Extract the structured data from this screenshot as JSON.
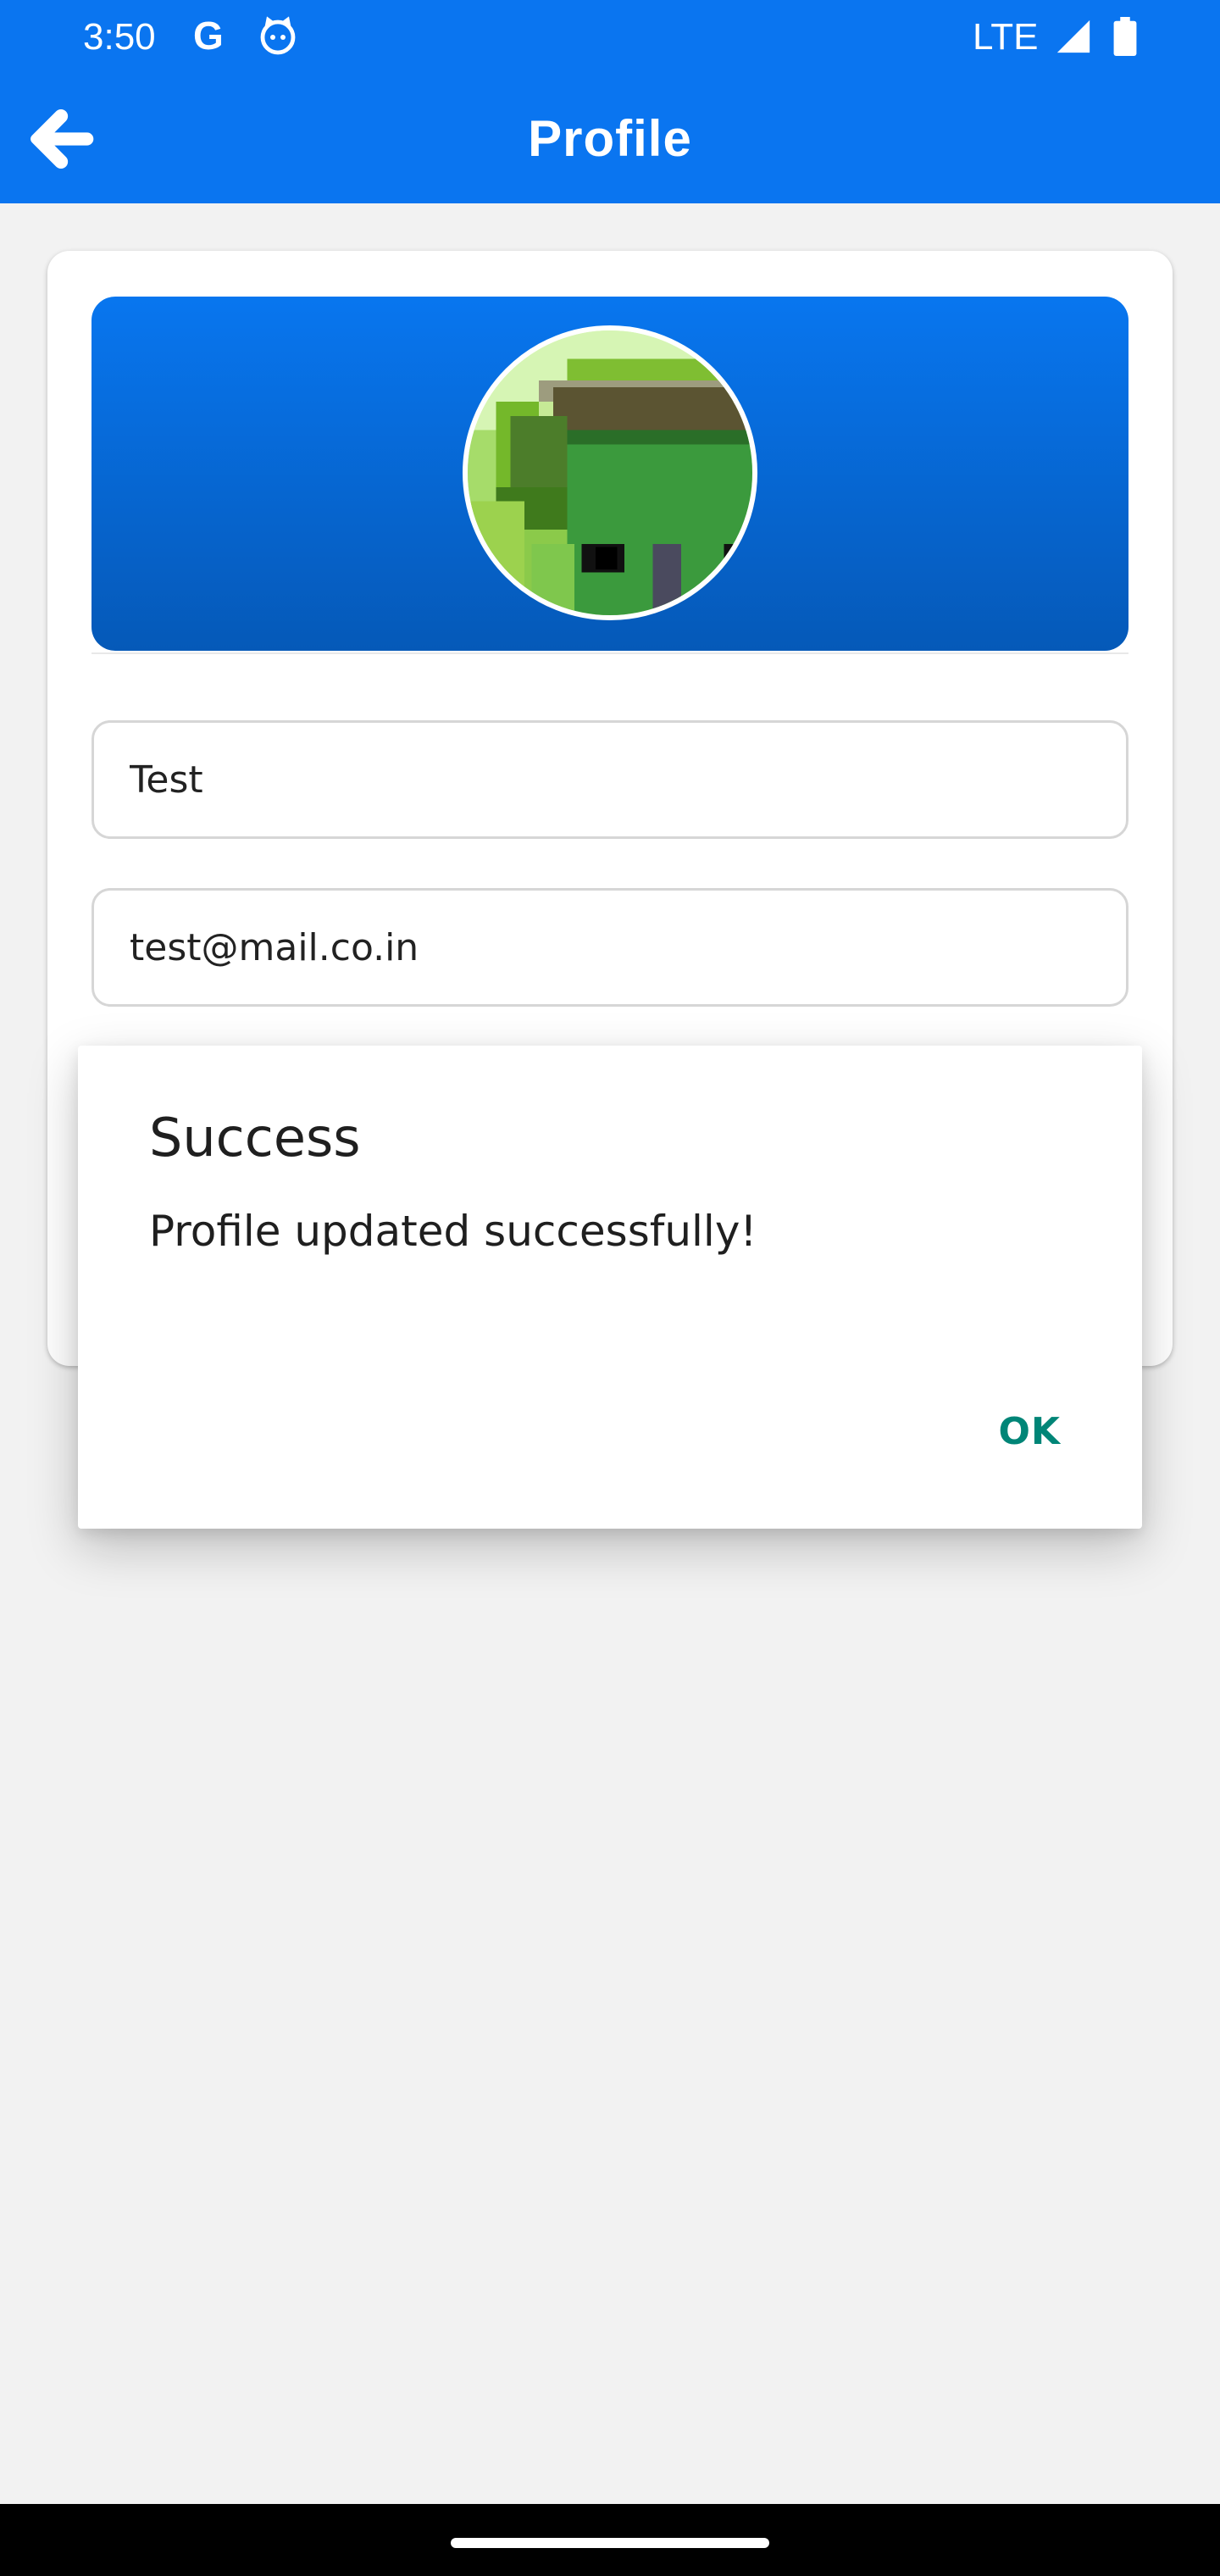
{
  "status_bar": {
    "time": "3:50",
    "google_icon": "G",
    "network": "LTE",
    "icons": [
      "google-icon",
      "cat-notification-icon",
      "signal-icon",
      "battery-icon"
    ]
  },
  "app_bar": {
    "title": "Profile",
    "back_icon": "arrow-left-icon",
    "color": "#0a75f0"
  },
  "profile": {
    "avatar_icon": "pixel-art-avatar",
    "name_value": "Test",
    "email_value": "test@mail.co.in"
  },
  "dialog": {
    "title": "Success",
    "message": "Profile updated successfully!",
    "ok_label": "OK",
    "ok_color": "#008577"
  }
}
